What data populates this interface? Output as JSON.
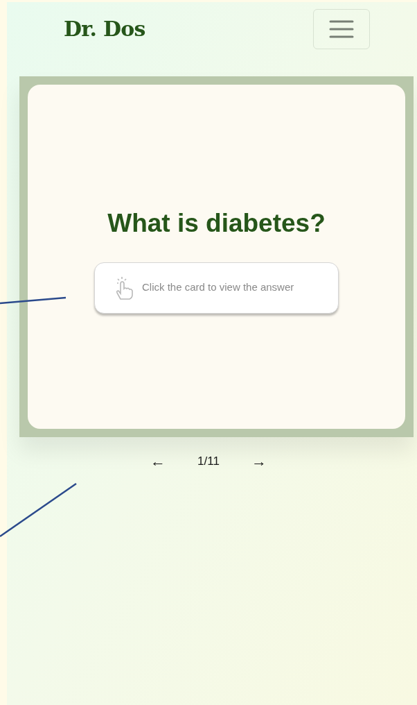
{
  "header": {
    "logo": "Dr. Dos"
  },
  "card": {
    "question": "What is diabetes?",
    "hint": "Click the card to view the answer"
  },
  "pager": {
    "previous": "←",
    "position": "1/11",
    "next": "→"
  }
}
